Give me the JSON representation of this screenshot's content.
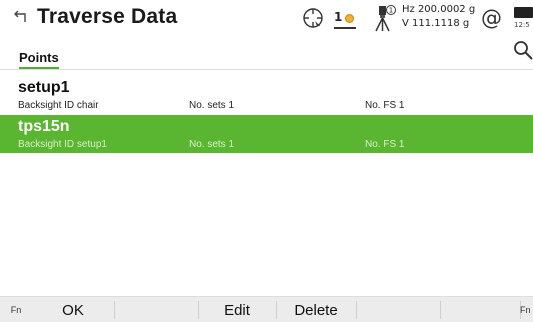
{
  "title_bar": {
    "title": "Traverse Data",
    "back_icon": "back-arrow-icon",
    "status": {
      "target_icon": "crosshair-target-icon",
      "prism_number": "1",
      "prism_icon": "prism-icon",
      "instrument_icon": "tripod-instrument-icon",
      "instrument_face": "1",
      "hz_reading": "Hz 200.0002 g",
      "v_reading": "V  111.1118 g",
      "connection_symbol": "@",
      "battery_icon": "battery-icon",
      "clock_partial": "12:5"
    }
  },
  "tabs": [
    {
      "label": "Points",
      "active": true
    }
  ],
  "search_icon": "search-icon",
  "rows": [
    {
      "name": "setup1",
      "backsight": "Backsight ID  chair",
      "sets": "No. sets  1",
      "fs": "No. FS  1",
      "selected": false
    },
    {
      "name": "tps15n",
      "backsight": "Backsight ID  setup1",
      "sets": "No. sets  1",
      "fs": "No. FS  1",
      "selected": true
    }
  ],
  "softkeys": {
    "fn_left": "Fn",
    "ok": "OK",
    "edit": "Edit",
    "delete": "Delete",
    "fn_right": "Fn"
  },
  "colors": {
    "selected_row": "#5ab531",
    "tab_underline": "#4caf2b",
    "softkey_bar": "#ececec"
  }
}
